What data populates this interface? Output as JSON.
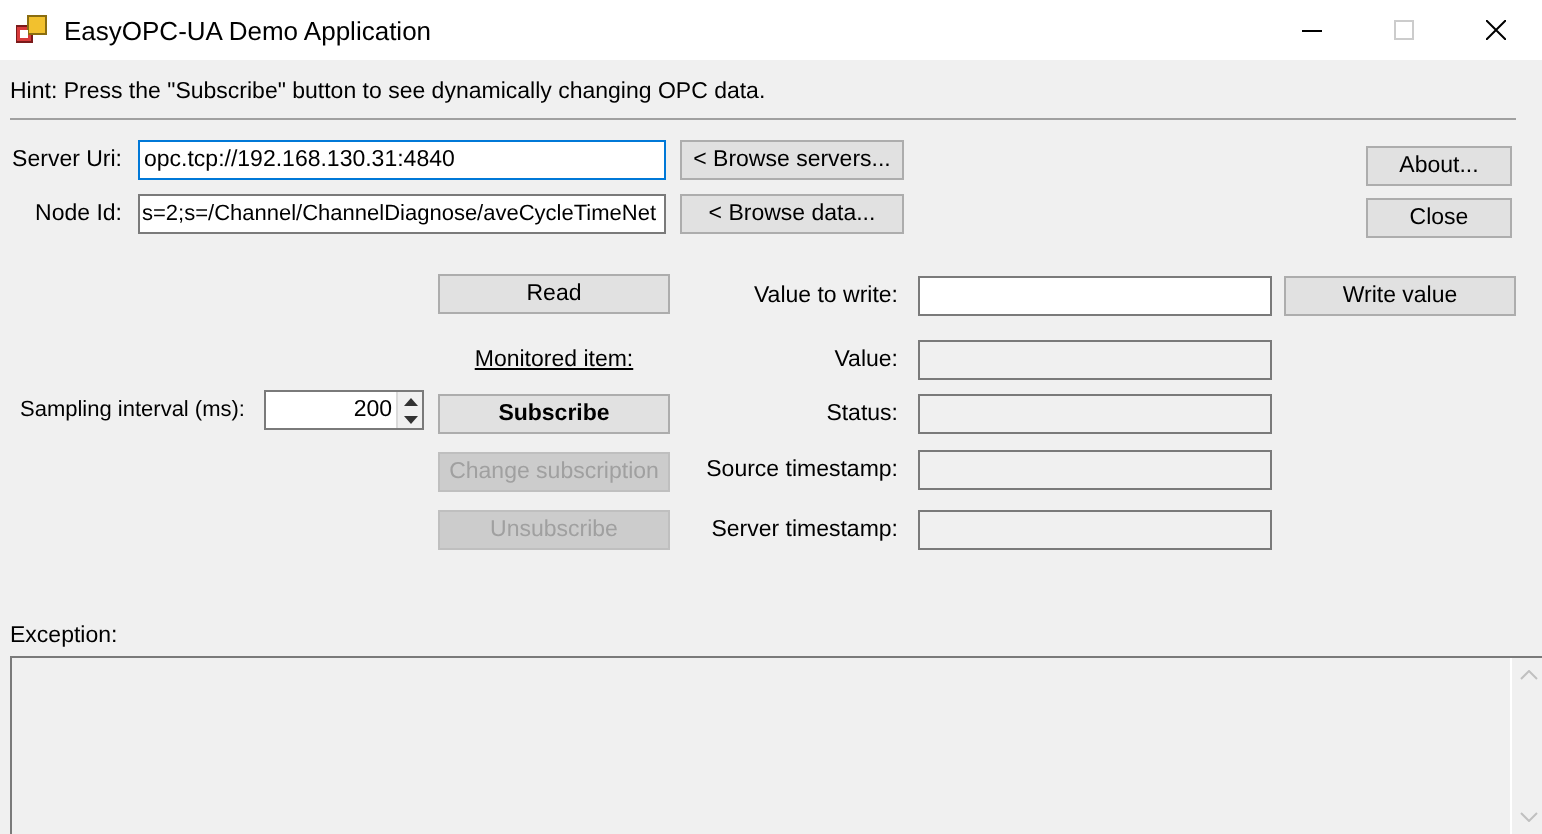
{
  "window": {
    "title": "EasyOPC-UA Demo Application",
    "controls": [
      {
        "kind": "minimize",
        "disabled": false
      },
      {
        "kind": "maximize",
        "disabled": true
      },
      {
        "kind": "close",
        "disabled": false
      }
    ]
  },
  "hint": "Hint: Press the \"Subscribe\" button to see dynamically changing OPC data.",
  "connection_rows": [
    {
      "label": "Server Uri:",
      "value": "opc.tcp://192.168.130.31:4840",
      "focused": true,
      "button": "< Browse servers..."
    },
    {
      "label": "Node Id:",
      "value": "s=2;s=/Channel/ChannelDiagnose/aveCycleTimeNet",
      "focused": false,
      "button": "< Browse data..."
    }
  ],
  "side_buttons": [
    "About...",
    "Close"
  ],
  "read_button": "Read",
  "value_to_write": {
    "label": "Value to write:",
    "button": "Write value"
  },
  "monitored_item_label": "Monitored item:",
  "sampling_interval": {
    "label": "Sampling interval (ms):",
    "value": "200"
  },
  "subscription_buttons": [
    {
      "label": "Subscribe",
      "emphasized": true,
      "disabled": false
    },
    {
      "label": "Change subscription",
      "emphasized": false,
      "disabled": true
    },
    {
      "label": "Unsubscribe",
      "emphasized": false,
      "disabled": true
    }
  ],
  "result_fields": [
    {
      "label": "Value:"
    },
    {
      "label": "Status:"
    },
    {
      "label": "Source timestamp:"
    },
    {
      "label": "Server timestamp:"
    }
  ],
  "exception": {
    "label": "Exception:"
  }
}
